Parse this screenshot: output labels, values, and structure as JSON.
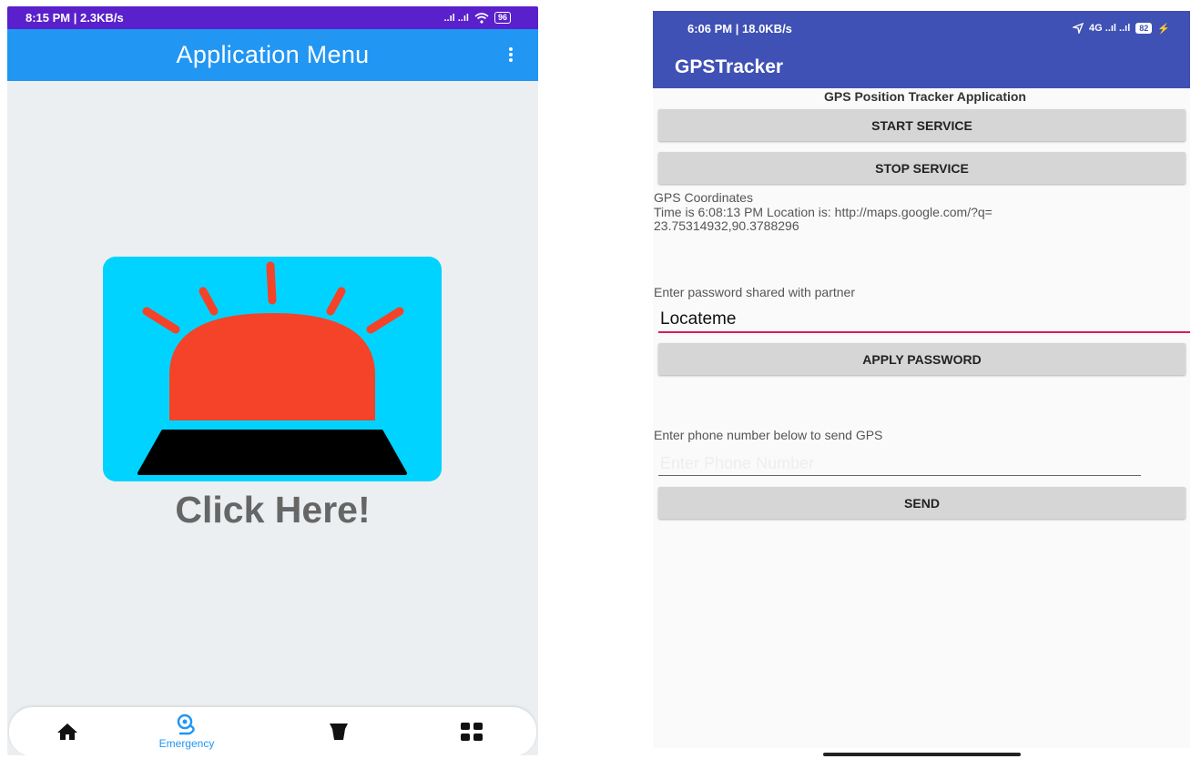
{
  "left_phone": {
    "status_bar": {
      "time_speed": "8:15 PM | 2.3KB/s",
      "signal": "..ıl ..ıl",
      "battery": "96"
    },
    "app_bar": {
      "title": "Application Menu",
      "menu_icon": "more-vert-icon"
    },
    "siren_button": {
      "icon": "siren-icon",
      "label": "Click Here!"
    },
    "bottom_nav": {
      "items": [
        {
          "icon": "home-icon",
          "label": ""
        },
        {
          "icon": "emergency-icon",
          "label": "Emergency"
        },
        {
          "icon": "cup-icon",
          "label": ""
        },
        {
          "icon": "grid-icon",
          "label": ""
        }
      ]
    },
    "colors": {
      "status_bar": "#5a20cb",
      "app_bar": "#2196f3",
      "siren_bg": "#00d3ff",
      "siren_dome": "#f44329",
      "accent": "#2196f3"
    }
  },
  "right_phone": {
    "status_bar": {
      "time_speed": "6:06 PM | 18.0KB/s",
      "network": "4G ..ıl ..ıl",
      "battery": "82"
    },
    "app_bar": {
      "title": "GPSTracker"
    },
    "subtitle": "GPS Position Tracker Application",
    "buttons": {
      "start": "START SERVICE",
      "stop": "STOP SERVICE",
      "apply": "APPLY PASSWORD",
      "send": "SEND"
    },
    "coords": {
      "heading": "GPS Coordinates",
      "line1": "Time is 6:08:13 PM Location is: http://maps.google.com/?q=",
      "line2": "23.75314932,90.3788296"
    },
    "password": {
      "label": "Enter password shared with partner",
      "value": "Locateme"
    },
    "phone": {
      "label": "Enter phone number below to send GPS",
      "placeholder": "Enter Phone Number"
    },
    "colors": {
      "primary": "#3f51b5",
      "button": "#d6d6d6",
      "input_underline_active": "#d81b60"
    }
  }
}
